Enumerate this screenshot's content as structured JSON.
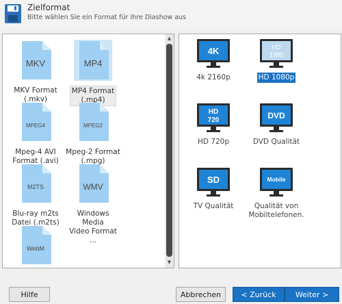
{
  "header": {
    "title": "Zielformat",
    "subtitle": "Bitte wählen Sie ein Format für Ihre Diashow aus",
    "icon": "save-disk-icon"
  },
  "formats": [
    {
      "badge": "MKV",
      "label": "MKV Format\n(.mkv)"
    },
    {
      "badge": "MP4",
      "label": "MP4 Format\n(.mp4)",
      "selected": true
    },
    {
      "badge": "MPEG4",
      "label": "Mpeg-4 AVI\nFormat (.avi)"
    },
    {
      "badge": "MPEG2",
      "label": "Mpeg-2 Format\n(.mpg)"
    },
    {
      "badge": "M2TS",
      "label": "Blu-ray m2ts\nDatei (.m2ts)"
    },
    {
      "badge": "WMV",
      "label": "Windows Media\nVideo Format ..."
    },
    {
      "badge": "WebM",
      "label": ""
    }
  ],
  "presets": [
    {
      "badge": "4K",
      "label": "4k 2160p"
    },
    {
      "badge": "HD\n1080",
      "label": "HD 1080p",
      "selected": true
    },
    {
      "badge": "HD\n720",
      "label": "HD 720p"
    },
    {
      "badge": "DVD",
      "label": "DVD Qualität"
    },
    {
      "badge": "SD",
      "label": "TV Qualität"
    },
    {
      "badge": "Mobile",
      "label": "Qualität von\nMobiltelefonen."
    }
  ],
  "buttons": {
    "help": "Hilfe",
    "cancel": "Abbrechen",
    "back": "< Zurück",
    "next": "Weiter >"
  },
  "colors": {
    "accent": "#1a73c4",
    "selection": "#1c73c3",
    "file_icon": "#9fd0f3",
    "tv_frame": "#2b2b2b"
  }
}
